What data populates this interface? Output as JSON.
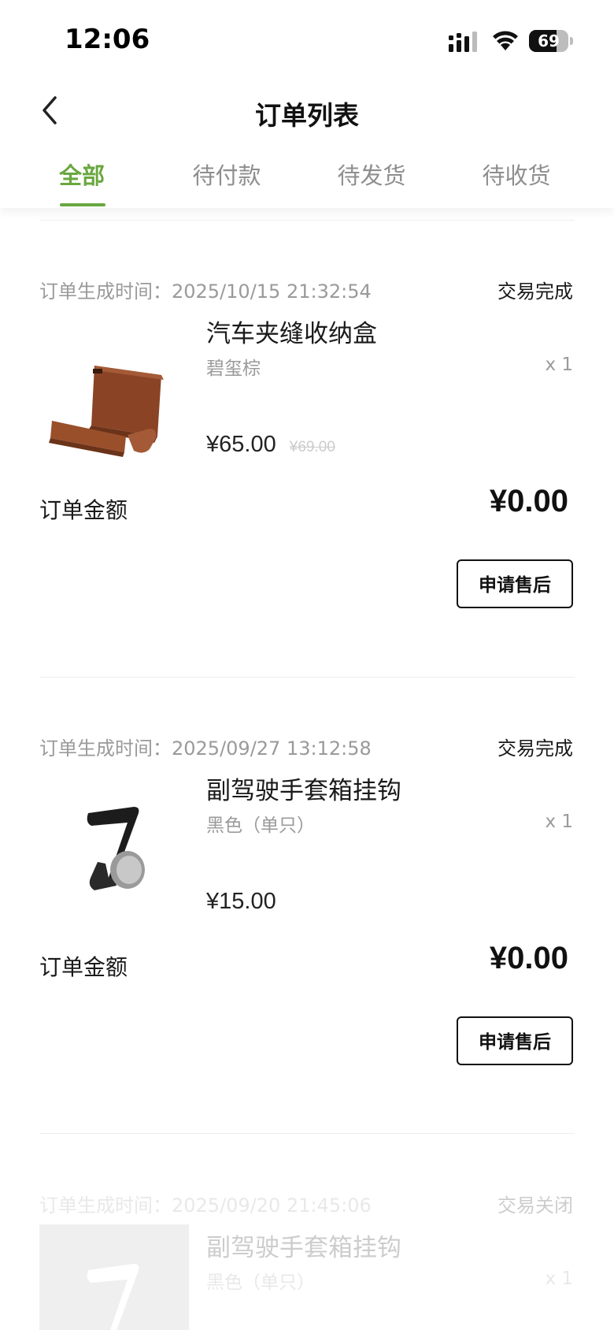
{
  "status_bar": {
    "time": "12:06",
    "battery": "69",
    "battery_level": 0.69
  },
  "nav": {
    "title": "订单列表",
    "back_icon": "chevron-left-icon"
  },
  "tabs": [
    {
      "label": "全部",
      "active": true
    },
    {
      "label": "待付款",
      "active": false
    },
    {
      "label": "待发货",
      "active": false
    },
    {
      "label": "待收货",
      "active": false
    }
  ],
  "accent_color": "#6aa73f",
  "orders": [
    {
      "time": "订单生成时间：2025/10/15 21:32:54",
      "status": "交易完成",
      "product": {
        "name": "汽车夹缝收纳盒",
        "variant": "碧玺棕",
        "qty": "x 1",
        "price": "¥65.00",
        "orig_price": "¥69.00",
        "image": "brown-storage-box"
      },
      "total_label": "订单金额",
      "total": "¥0.00",
      "action": "申请售后"
    },
    {
      "time": "订单生成时间：2025/09/27 13:12:58",
      "status": "交易完成",
      "product": {
        "name": "副驾驶手套箱挂钩",
        "variant": "黑色（单只）",
        "qty": "x 1",
        "price": "¥15.00",
        "image": "black-hook"
      },
      "total_label": "订单金额",
      "total": "¥0.00",
      "action": "申请售后"
    },
    {
      "time": "订单生成时间：2025/09/20 21:45:06",
      "status": "交易关闭",
      "product": {
        "name": "副驾驶手套箱挂钩",
        "variant": "黑色（单只）",
        "qty": "x 1",
        "image": "black-hook"
      }
    }
  ]
}
